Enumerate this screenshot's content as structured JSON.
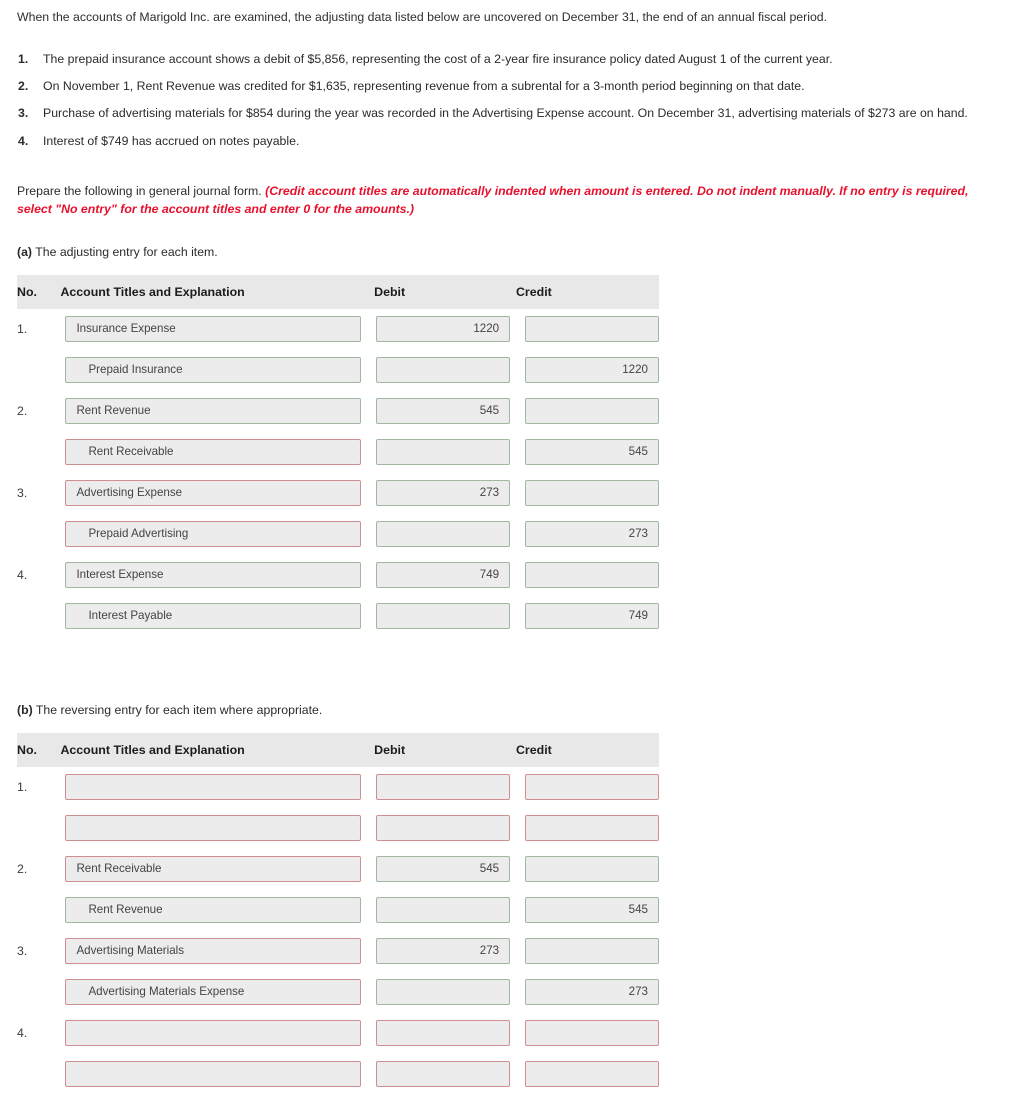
{
  "intro": "When the accounts of Marigold Inc. are examined, the adjusting data listed below are uncovered on December 31, the end of an annual fiscal period.",
  "facts": [
    "The prepaid insurance account shows a debit of $5,856, representing the cost of a 2-year fire insurance policy dated August 1 of the current year.",
    "On November 1, Rent Revenue was credited for $1,635, representing revenue from a subrental for a 3-month period beginning on that date.",
    "Purchase of advertising materials for $854 during the year was recorded in the Advertising Expense account. On December 31, advertising materials of $273 are on hand.",
    "Interest of $749 has accrued on notes payable."
  ],
  "prepare": {
    "lead": "Prepare the following in general journal form.",
    "note": "(Credit account titles are automatically indented when amount is entered. Do not indent manually. If no entry is required, select \"No entry\" for the account titles and enter 0 for the amounts.)"
  },
  "colors": {
    "error_border": "#cf8e90",
    "valid_border": "#9fb89f",
    "field_fill": "#ececec",
    "header_fill": "#e8e8e8",
    "note_red": "#e8112d"
  },
  "columns": {
    "no": "No.",
    "account": "Account Titles and Explanation",
    "debit": "Debit",
    "credit": "Credit"
  },
  "part_a": {
    "label_prefix": "(a)",
    "label_text": " The adjusting entry for each item.",
    "rows": [
      {
        "no": "1.",
        "account": "Insurance Expense",
        "indent": false,
        "acct_state": "valid",
        "debit": "1220",
        "debit_state": "valid",
        "credit": "",
        "credit_state": "valid"
      },
      {
        "no": "",
        "account": "Prepaid Insurance",
        "indent": true,
        "acct_state": "valid",
        "debit": "",
        "debit_state": "valid",
        "credit": "1220",
        "credit_state": "valid"
      },
      {
        "no": "2.",
        "account": "Rent Revenue",
        "indent": false,
        "acct_state": "valid",
        "debit": "545",
        "debit_state": "valid",
        "credit": "",
        "credit_state": "valid"
      },
      {
        "no": "",
        "account": "Rent Receivable",
        "indent": true,
        "acct_state": "error",
        "debit": "",
        "debit_state": "valid",
        "credit": "545",
        "credit_state": "valid"
      },
      {
        "no": "3.",
        "account": "Advertising Expense",
        "indent": false,
        "acct_state": "error",
        "debit": "273",
        "debit_state": "valid",
        "credit": "",
        "credit_state": "valid"
      },
      {
        "no": "",
        "account": "Prepaid Advertising",
        "indent": true,
        "acct_state": "error",
        "debit": "",
        "debit_state": "valid",
        "credit": "273",
        "credit_state": "valid"
      },
      {
        "no": "4.",
        "account": "Interest Expense",
        "indent": false,
        "acct_state": "valid",
        "debit": "749",
        "debit_state": "valid",
        "credit": "",
        "credit_state": "valid"
      },
      {
        "no": "",
        "account": "Interest Payable",
        "indent": true,
        "acct_state": "valid",
        "debit": "",
        "debit_state": "valid",
        "credit": "749",
        "credit_state": "valid"
      }
    ]
  },
  "part_b": {
    "label_prefix": "(b)",
    "label_text": " The reversing entry for each item where appropriate.",
    "rows": [
      {
        "no": "1.",
        "account": "",
        "indent": false,
        "acct_state": "error",
        "debit": "",
        "debit_state": "error",
        "credit": "",
        "credit_state": "error"
      },
      {
        "no": "",
        "account": "",
        "indent": true,
        "acct_state": "error",
        "debit": "",
        "debit_state": "error",
        "credit": "",
        "credit_state": "error"
      },
      {
        "no": "2.",
        "account": "Rent Receivable",
        "indent": false,
        "acct_state": "error",
        "debit": "545",
        "debit_state": "valid",
        "credit": "",
        "credit_state": "valid"
      },
      {
        "no": "",
        "account": "Rent Revenue",
        "indent": true,
        "acct_state": "valid",
        "debit": "",
        "debit_state": "valid",
        "credit": "545",
        "credit_state": "valid"
      },
      {
        "no": "3.",
        "account": "Advertising Materials",
        "indent": false,
        "acct_state": "error",
        "debit": "273",
        "debit_state": "valid",
        "credit": "",
        "credit_state": "valid"
      },
      {
        "no": "",
        "account": "Advertising Materials Expense",
        "indent": true,
        "acct_state": "error",
        "debit": "",
        "debit_state": "valid",
        "credit": "273",
        "credit_state": "valid"
      },
      {
        "no": "4.",
        "account": "",
        "indent": false,
        "acct_state": "error",
        "debit": "",
        "debit_state": "error",
        "credit": "",
        "credit_state": "error"
      },
      {
        "no": "",
        "account": "",
        "indent": true,
        "acct_state": "error",
        "debit": "",
        "debit_state": "error",
        "credit": "",
        "credit_state": "error"
      }
    ]
  }
}
